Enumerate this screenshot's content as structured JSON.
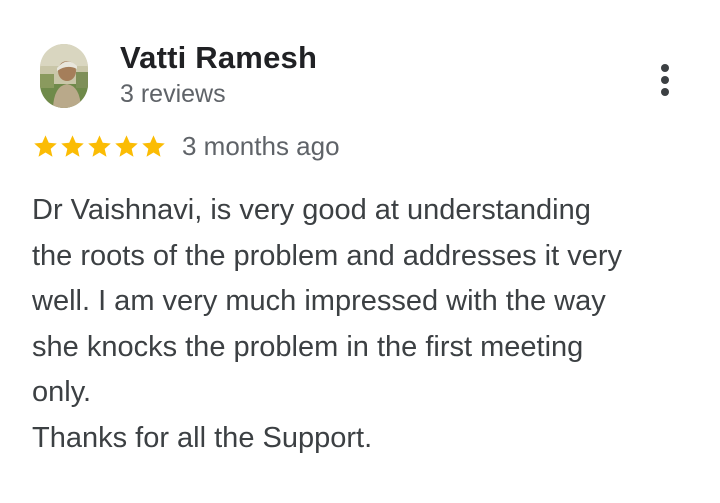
{
  "reviewer": {
    "name": "Vatti Ramesh",
    "review_count": "3 reviews",
    "avatar_icon": "user-photo-avatar"
  },
  "menu": {
    "icon": "more-vert-icon"
  },
  "rating": {
    "stars": 5,
    "max_stars": 5,
    "star_color": "#FBBC04",
    "date": "3 months ago"
  },
  "review": {
    "lines": [
      "Dr Vaishnavi, is very good at understanding",
      "the roots of the problem and addresses it very",
      "well. I am very much impressed with the way",
      "she knocks the problem in the first meeting",
      "only.",
      "Thanks for all the Support."
    ]
  },
  "colors": {
    "name_text": "#202124",
    "secondary_text": "#5f6368",
    "body_text": "#3c4043",
    "background": "#ffffff"
  }
}
